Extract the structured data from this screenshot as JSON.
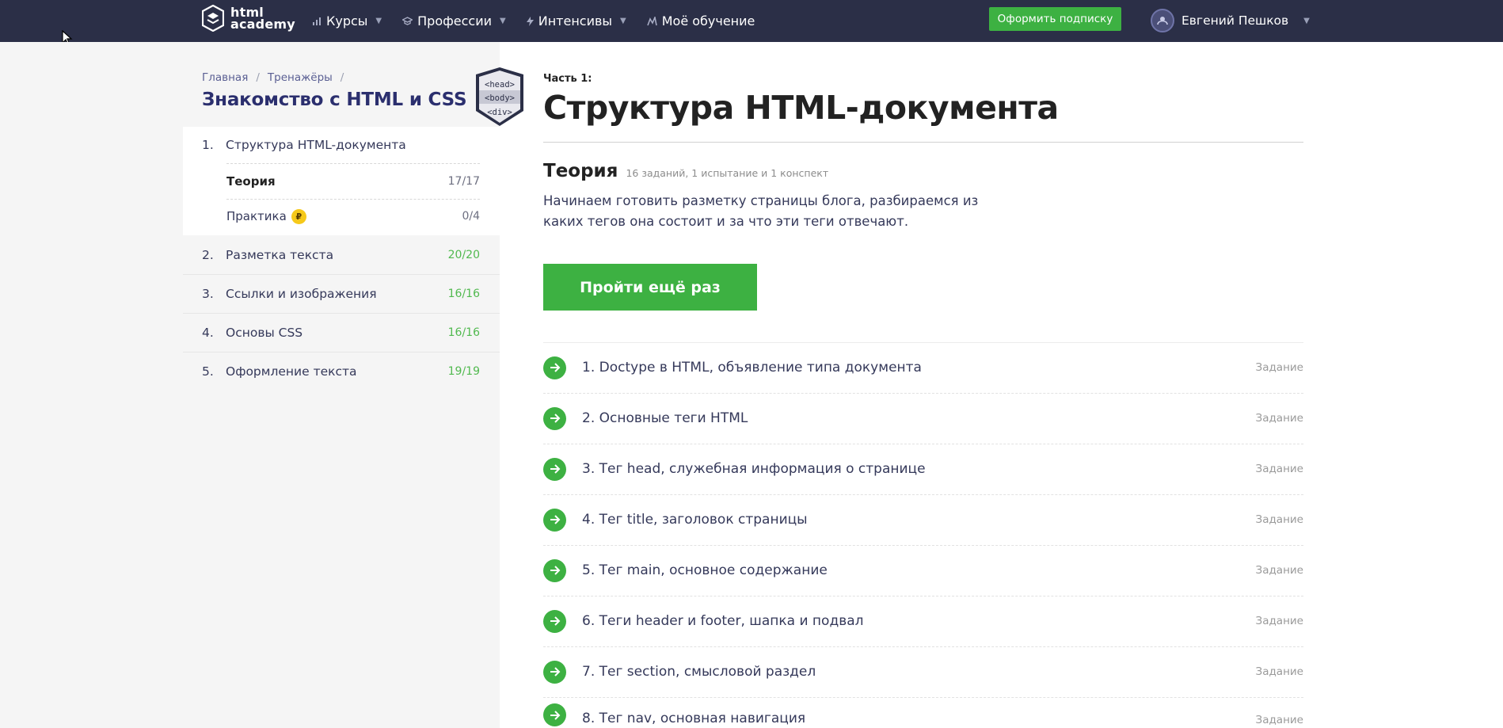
{
  "header": {
    "logo": {
      "line1": "html",
      "line2": "academy"
    },
    "nav": [
      {
        "label": "Курсы",
        "icon": "chart-icon"
      },
      {
        "label": "Профессии",
        "icon": "graduation-cap-icon"
      },
      {
        "label": "Интенсивы",
        "icon": "bolt-icon"
      },
      {
        "label": "Моё обучение",
        "icon": "learning-icon"
      }
    ],
    "subscribe_label": "Оформить подписку",
    "user_name": "Евгений Пешков"
  },
  "sidebar": {
    "breadcrumb": [
      "Главная",
      "Тренажёры"
    ],
    "course_title": "Знакомство с HTML и CSS",
    "badge_lines": [
      "<head>",
      "<body>",
      "<div>"
    ],
    "chapters": [
      {
        "num": "1.",
        "label": "Структура HTML-документа",
        "score": ""
      },
      {
        "num": "2.",
        "label": "Разметка текста",
        "score": "20/20"
      },
      {
        "num": "3.",
        "label": "Ссылки и изображения",
        "score": "16/16"
      },
      {
        "num": "4.",
        "label": "Основы CSS",
        "score": "16/16"
      },
      {
        "num": "5.",
        "label": "Оформление текста",
        "score": "19/19"
      }
    ],
    "subitems": [
      {
        "label": "Теория",
        "score": "17/17"
      },
      {
        "label": "Практика",
        "score": "0/4",
        "coin": "₽"
      }
    ]
  },
  "main": {
    "part_label": "Часть 1:",
    "title": "Структура HTML-документа",
    "theory_heading": "Теория",
    "theory_meta": "16 заданий, 1 испытание и 1 конспект",
    "description": "Начинаем готовить разметку страницы блога, разбираемся из каких тегов она состоит и за что эти теги отвечают.",
    "again_label": "Пройти ещё раз",
    "tasks": [
      {
        "title": "1. Doctype в HTML, объявление типа документа",
        "type": "Задание"
      },
      {
        "title": "2. Основные теги HTML",
        "type": "Задание"
      },
      {
        "title": "3. Тег head, служебная информация о странице",
        "type": "Задание"
      },
      {
        "title": "4. Тег title, заголовок страницы",
        "type": "Задание"
      },
      {
        "title": "5. Тег main, основное содержание",
        "type": "Задание"
      },
      {
        "title": "6. Теги header и footer, шапка и подвал",
        "type": "Задание"
      },
      {
        "title": "7. Тег section, смысловой раздел",
        "type": "Задание"
      },
      {
        "title": "8. Тег nav, основная навигация",
        "type": "Задание"
      }
    ]
  },
  "colors": {
    "topbar": "#2b2f47",
    "accent_green": "#3db142",
    "title_purple": "#2b2f6e"
  }
}
